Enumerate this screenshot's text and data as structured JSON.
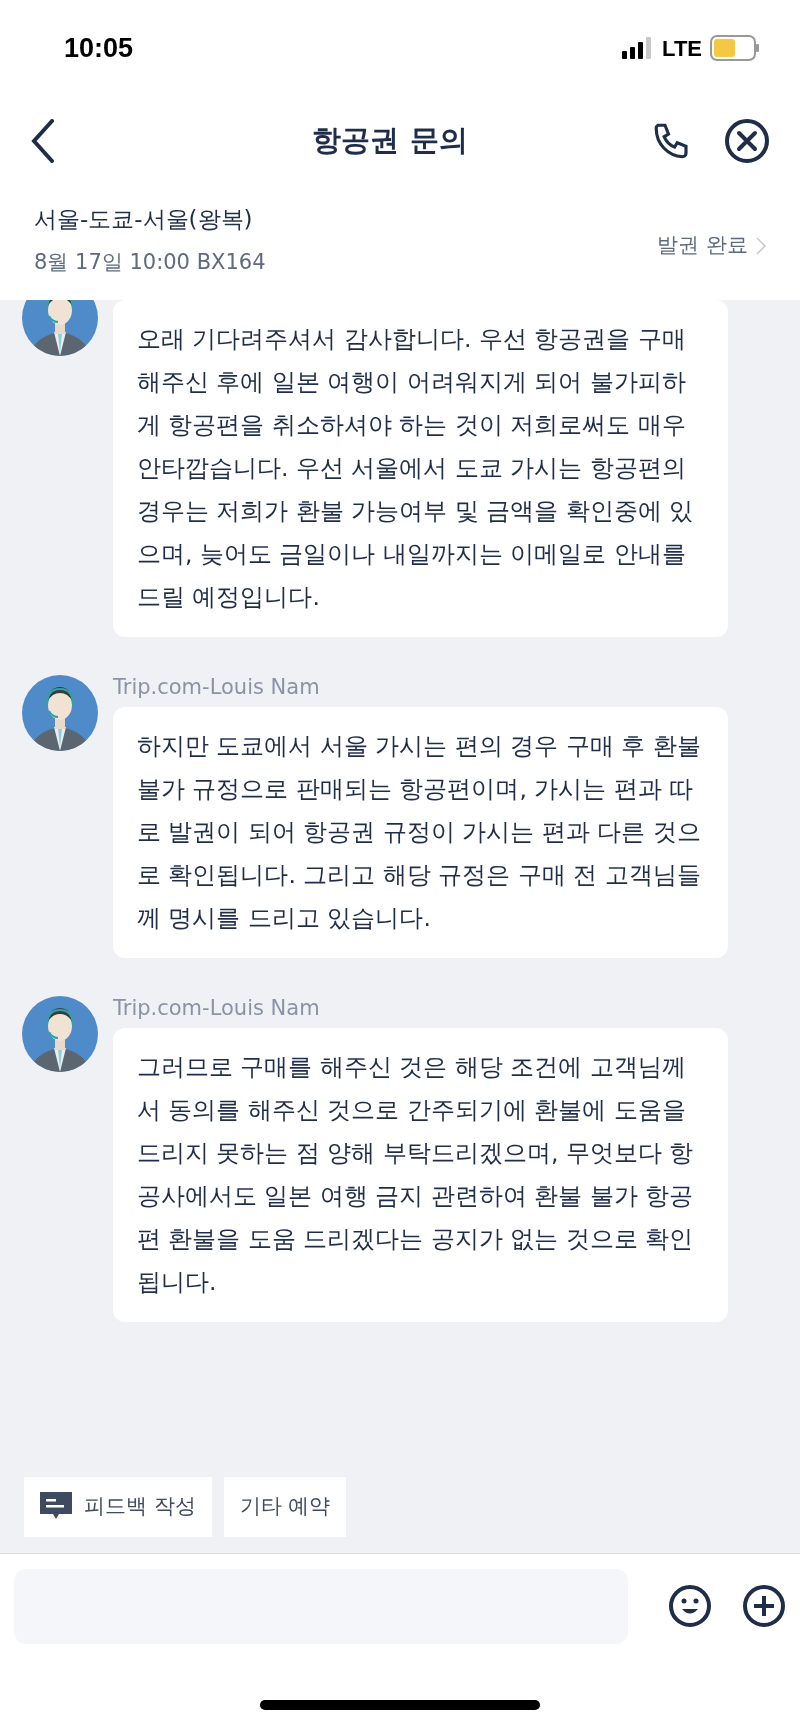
{
  "status_bar": {
    "time": "10:05",
    "network": "LTE"
  },
  "nav": {
    "title": "항공권 문의"
  },
  "booking": {
    "route": "서울-도쿄-서울(왕복)",
    "details": "8월 17일 10:00 BX164",
    "status": "발권 완료"
  },
  "messages": [
    {
      "text": "오래 기다려주셔서 감사합니다. 우선 항공권을 구매해주신 후에 일본 여행이 어려워지게 되어 불가피하게 항공편을 취소하셔야 하는 것이 저희로써도 매우 안타깝습니다. 우선 서울에서 도쿄 가시는 항공편의 경우는 저희가 환불 가능여부 및 금액을 확인중에 있으며, 늦어도 금일이나 내일까지는 이메일로 안내를 드릴 예정입니다."
    },
    {
      "sender": "Trip.com-Louis Nam",
      "text": "하지만 도쿄에서 서울 가시는 편의 경우 구매 후 환불 불가 규정으로 판매되는 항공편이며, 가시는 편과 따로 발권이 되어 항공권 규정이 가시는 편과 다른 것으로 확인됩니다. 그리고 해당 규정은 구매 전 고객님들께 명시를 드리고 있습니다."
    },
    {
      "sender": "Trip.com-Louis Nam",
      "text": "그러므로 구매를 해주신 것은 해당 조건에 고객님께서 동의를 해주신 것으로 간주되기에 환불에 도움을 드리지 못하는 점 양해 부탁드리겠으며, 무엇보다 항공사에서도 일본 여행 금지 관련하여 환불 불가 항공편 환불을 도움 드리겠다는 공지가 없는 것으로 확인됩니다."
    }
  ],
  "quick_actions": [
    {
      "label": "피드백 작성",
      "kind": "feedback"
    },
    {
      "label": "기타 예약",
      "kind": "plain"
    }
  ]
}
